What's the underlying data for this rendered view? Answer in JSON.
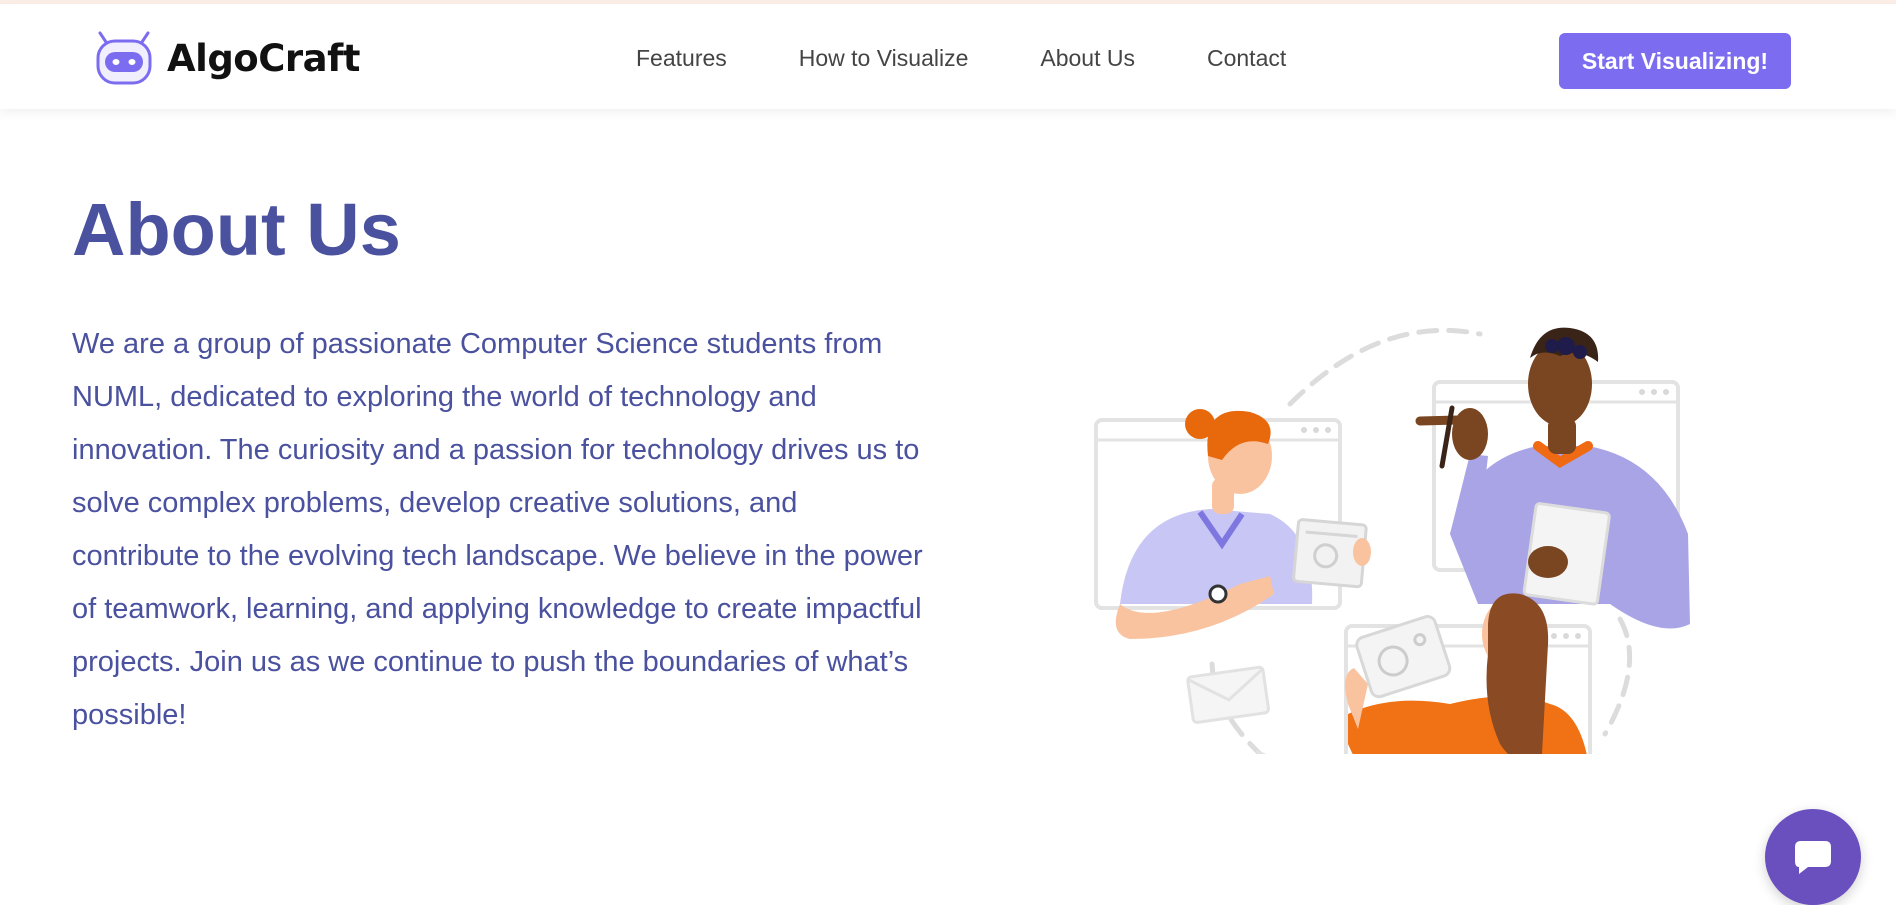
{
  "brand": {
    "name": "AlgoCraft",
    "accent": "#7b6cf0",
    "text_color": "#4a519e"
  },
  "nav": {
    "items": [
      {
        "label": "Features"
      },
      {
        "label": "How to Visualize"
      },
      {
        "label": "About Us"
      },
      {
        "label": "Contact"
      }
    ],
    "cta_label": "Start Visualizing!"
  },
  "about": {
    "title": "About Us",
    "body": "We are a group of passionate Computer Science students from NUML, dedicated to exploring the world of technology and innovation. The curiosity and a passion for technology drives us to solve complex problems, develop creative solutions, and contribute to the evolving tech landscape. We believe in the power of teamwork, learning, and applying knowledge to create impactful projects. Join us as we continue to push the boundaries of what’s possible!"
  },
  "icons": {
    "logo": "robot-icon",
    "chat": "chat-bubble-icon"
  }
}
